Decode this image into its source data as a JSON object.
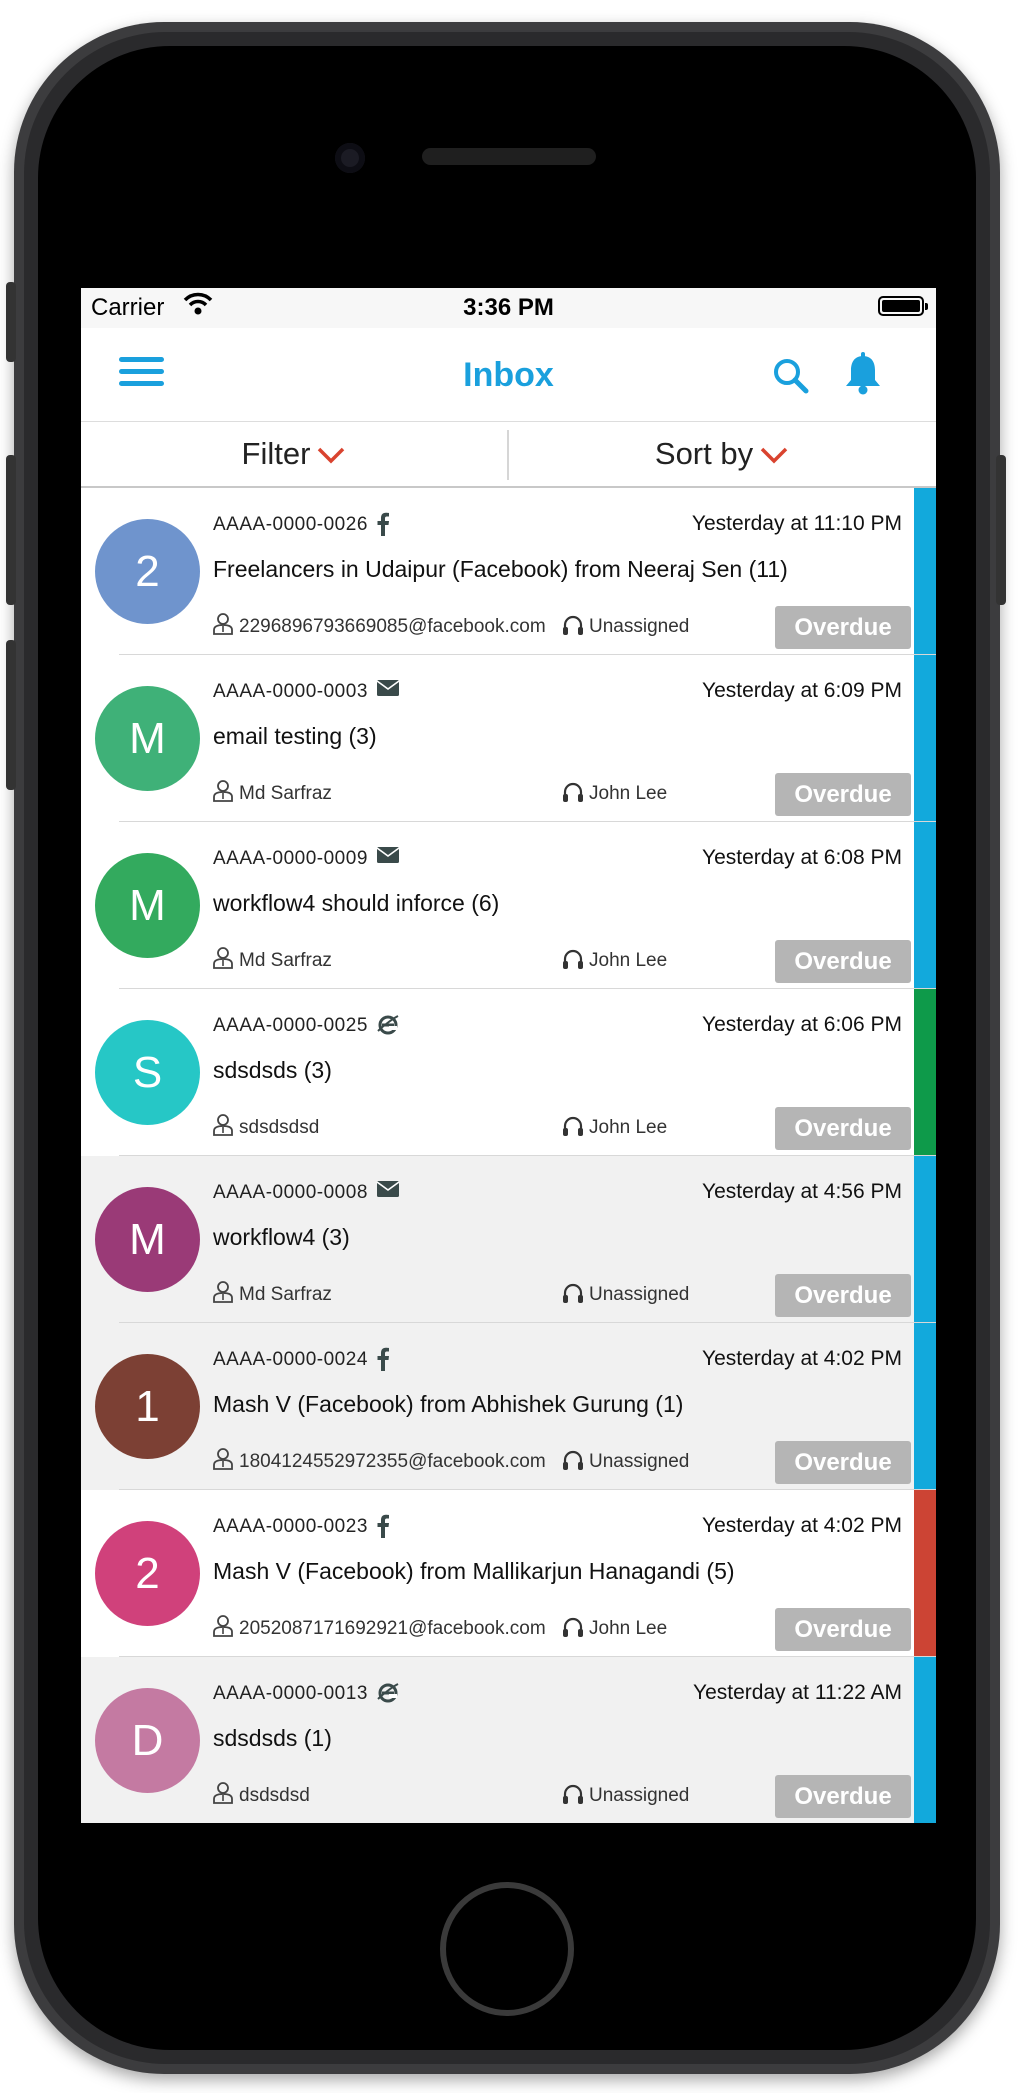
{
  "status_bar": {
    "carrier": "Carrier",
    "time": "3:36 PM"
  },
  "nav": {
    "title": "Inbox"
  },
  "toolbar": {
    "filter_label": "Filter",
    "sort_label": "Sort by"
  },
  "colors": {
    "accent": "#1aa0dd",
    "chevron": "#d9432f",
    "overdue_bg": "#b5b5b5"
  },
  "tickets": [
    {
      "avatar": "2",
      "avatar_color": "#6f94cd",
      "id": "AAAA-0000-0026",
      "channel": "facebook-icon",
      "time": "Yesterday at 11:10 PM",
      "subject": "Freelancers in Udaipur (Facebook) from Neeraj Sen (11)",
      "contact": "2296896793669085@facebook.com",
      "agent": "Unassigned",
      "status": "Overdue",
      "stripe": "#12a9dc",
      "bg": "#ffffff"
    },
    {
      "avatar": "M",
      "avatar_color": "#3fb178",
      "id": "AAAA-0000-0003",
      "channel": "email-icon",
      "time": "Yesterday at 6:09 PM",
      "subject": "email testing (3)",
      "contact": "Md Sarfraz",
      "agent": "John  Lee",
      "status": "Overdue",
      "stripe": "#12a9dc",
      "bg": "#ffffff"
    },
    {
      "avatar": "M",
      "avatar_color": "#33aa5e",
      "id": "AAAA-0000-0009",
      "channel": "email-icon",
      "time": "Yesterday at 6:08 PM",
      "subject": "workflow4 should inforce (6)",
      "contact": "Md Sarfraz",
      "agent": "John  Lee",
      "status": "Overdue",
      "stripe": "#12a9dc",
      "bg": "#ffffff"
    },
    {
      "avatar": "S",
      "avatar_color": "#26c7c6",
      "id": "AAAA-0000-0025",
      "channel": "web-icon",
      "time": "Yesterday at 6:06 PM",
      "subject": "sdsdsds (3)",
      "contact": "sdsdsdsd",
      "agent": "John  Lee",
      "status": "Overdue",
      "stripe": "#0e9a4a",
      "bg": "#ffffff"
    },
    {
      "avatar": "M",
      "avatar_color": "#9a3a77",
      "id": "AAAA-0000-0008",
      "channel": "email-icon",
      "time": "Yesterday at 4:56 PM",
      "subject": "workflow4 (3)",
      "contact": "Md Sarfraz",
      "agent": "Unassigned",
      "status": "Overdue",
      "stripe": "#12a9dc",
      "bg": "#f1f1f1"
    },
    {
      "avatar": "1",
      "avatar_color": "#7c4034",
      "id": "AAAA-0000-0024",
      "channel": "facebook-icon",
      "time": "Yesterday at 4:02 PM",
      "subject": "Mash V (Facebook) from Abhishek Gurung (1)",
      "contact": "1804124552972355@facebook.com",
      "agent": "Unassigned",
      "status": "Overdue",
      "stripe": "#12a9dc",
      "bg": "#f1f1f1"
    },
    {
      "avatar": "2",
      "avatar_color": "#d0417b",
      "id": "AAAA-0000-0023",
      "channel": "facebook-icon",
      "time": "Yesterday at 4:02 PM",
      "subject": "Mash V (Facebook) from Mallikarjun Hanagandi (5)",
      "contact": "2052087171692921@facebook.com",
      "agent": "John  Lee",
      "status": "Overdue",
      "stripe": "#cc4434",
      "bg": "#ffffff"
    },
    {
      "avatar": "D",
      "avatar_color": "#c47aa2",
      "id": "AAAA-0000-0013",
      "channel": "web-icon",
      "time": "Yesterday at 11:22 AM",
      "subject": "sdsdsds (1)",
      "contact": "dsdsdsd",
      "agent": "Unassigned",
      "status": "Overdue",
      "stripe": "#12a9dc",
      "bg": "#f1f1f1"
    }
  ]
}
